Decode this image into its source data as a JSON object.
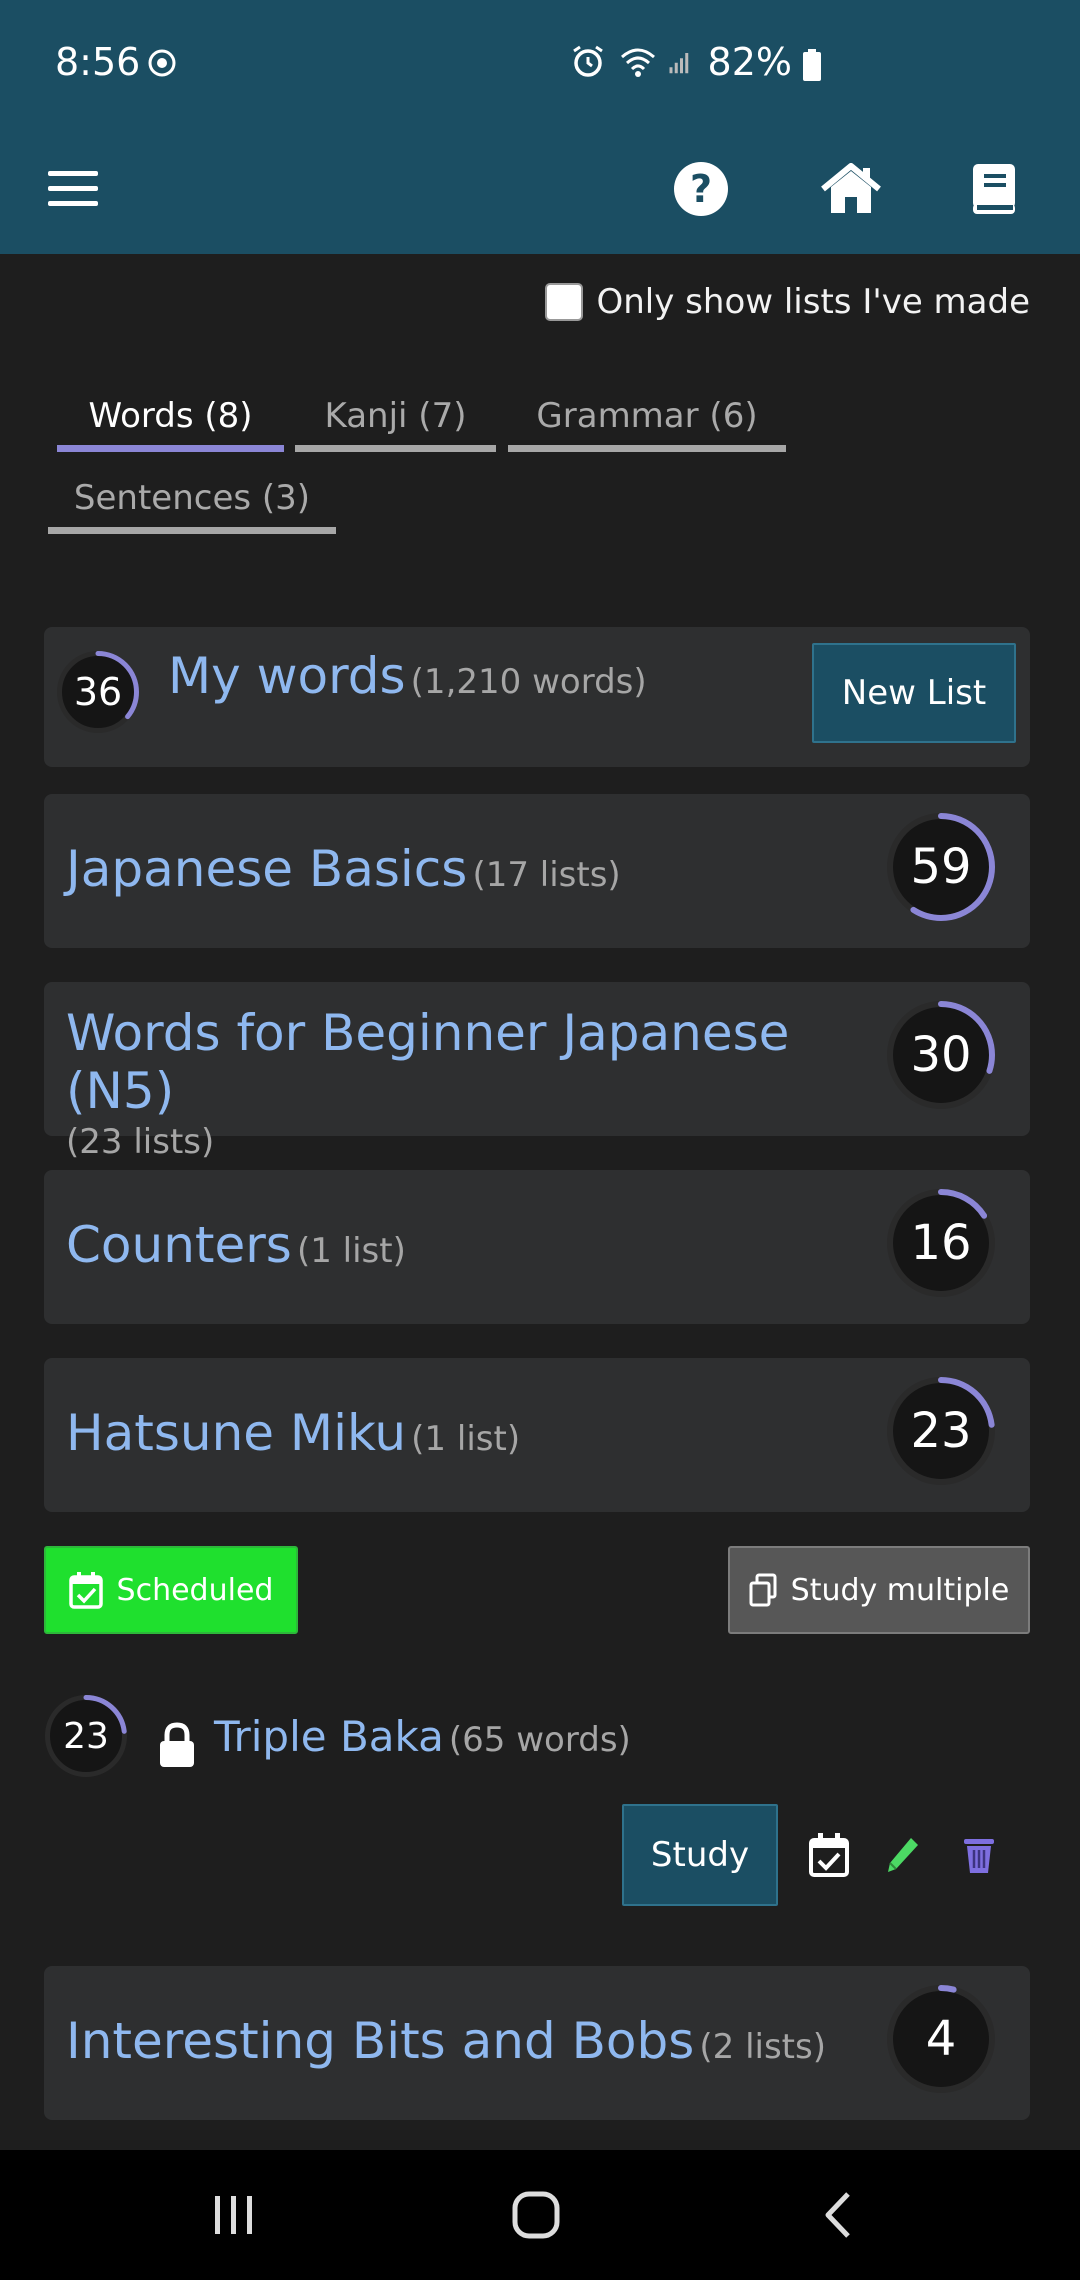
{
  "status": {
    "time": "8:56",
    "battery": "82%",
    "icons": [
      "sync-icon",
      "alarm-icon",
      "wifi-icon",
      "signal-icon",
      "battery-icon"
    ]
  },
  "appbar": {
    "icons": [
      "menu-icon",
      "help-icon",
      "home-icon",
      "book-icon"
    ],
    "color": "#1b4e63"
  },
  "filter": {
    "only_mine_label": "Only show lists I've made",
    "checked": false
  },
  "tabs": [
    {
      "label": "Words (8)",
      "active": true
    },
    {
      "label": "Kanji (7)",
      "active": false
    },
    {
      "label": "Grammar (6)",
      "active": false
    },
    {
      "label": "Sentences (3)",
      "active": false
    }
  ],
  "my_words": {
    "score": "36",
    "title": "My words",
    "count": "(1,210 words)",
    "new_list_label": "New List",
    "progress": 0.36
  },
  "groups": [
    {
      "title": "Japanese Basics",
      "count": "(17 lists)",
      "score": "59",
      "progress": 0.59
    },
    {
      "title": "Words for Beginner Japanese (N5)",
      "count": "(23 lists)",
      "score": "30",
      "progress": 0.3
    },
    {
      "title": "Counters",
      "count": "(1 list)",
      "score": "16",
      "progress": 0.16
    },
    {
      "title": "Hatsune Miku",
      "count": "(1 list)",
      "score": "23",
      "progress": 0.23
    }
  ],
  "actions": {
    "scheduled_label": "Scheduled",
    "study_multiple_label": "Study multiple",
    "scheduled_color": "#1fe02e"
  },
  "list_item": {
    "score": "23",
    "title": "Triple Baka",
    "count": "(65 words)",
    "study_label": "Study",
    "progress": 0.23
  },
  "last_group": {
    "title": "Interesting Bits and Bobs",
    "count": "(2 lists)",
    "score": "4",
    "progress": 0.04
  },
  "accent": "#8b86d6"
}
